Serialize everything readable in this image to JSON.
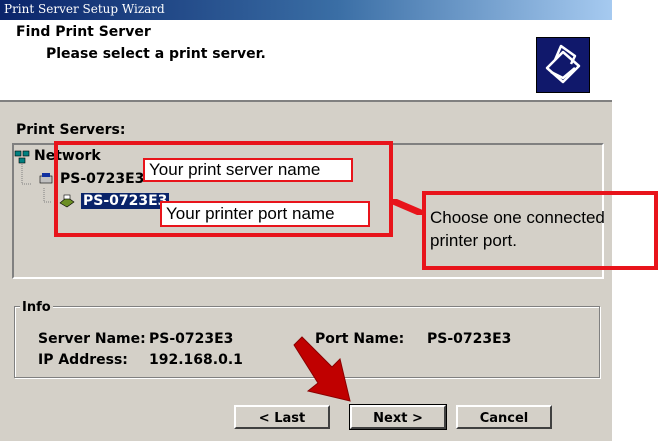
{
  "window": {
    "title": "Print Server Setup Wizard"
  },
  "header": {
    "title": "Find Print Server",
    "subtitle": "Please select a print server.",
    "icon": "printer-icon"
  },
  "servers": {
    "label": "Print Servers:",
    "tree": {
      "root": "Network",
      "server": "PS-0723E3",
      "port": "PS-0723E3"
    }
  },
  "info": {
    "legend": "Info",
    "server_name_label": "Server Name:",
    "server_name": "PS-0723E3",
    "port_name_label": "Port Name:",
    "port_name": "PS-0723E3",
    "ip_label": "IP Address:",
    "ip": "192.168.0.1"
  },
  "buttons": {
    "last": "< Last",
    "next": "Next >",
    "cancel": "Cancel"
  },
  "annotations": {
    "server_callout": "Your print server name",
    "port_callout": "Your printer port name",
    "choose_line1": "Choose one connected",
    "choose_line2": "printer port.",
    "accent": "#e8141b"
  }
}
